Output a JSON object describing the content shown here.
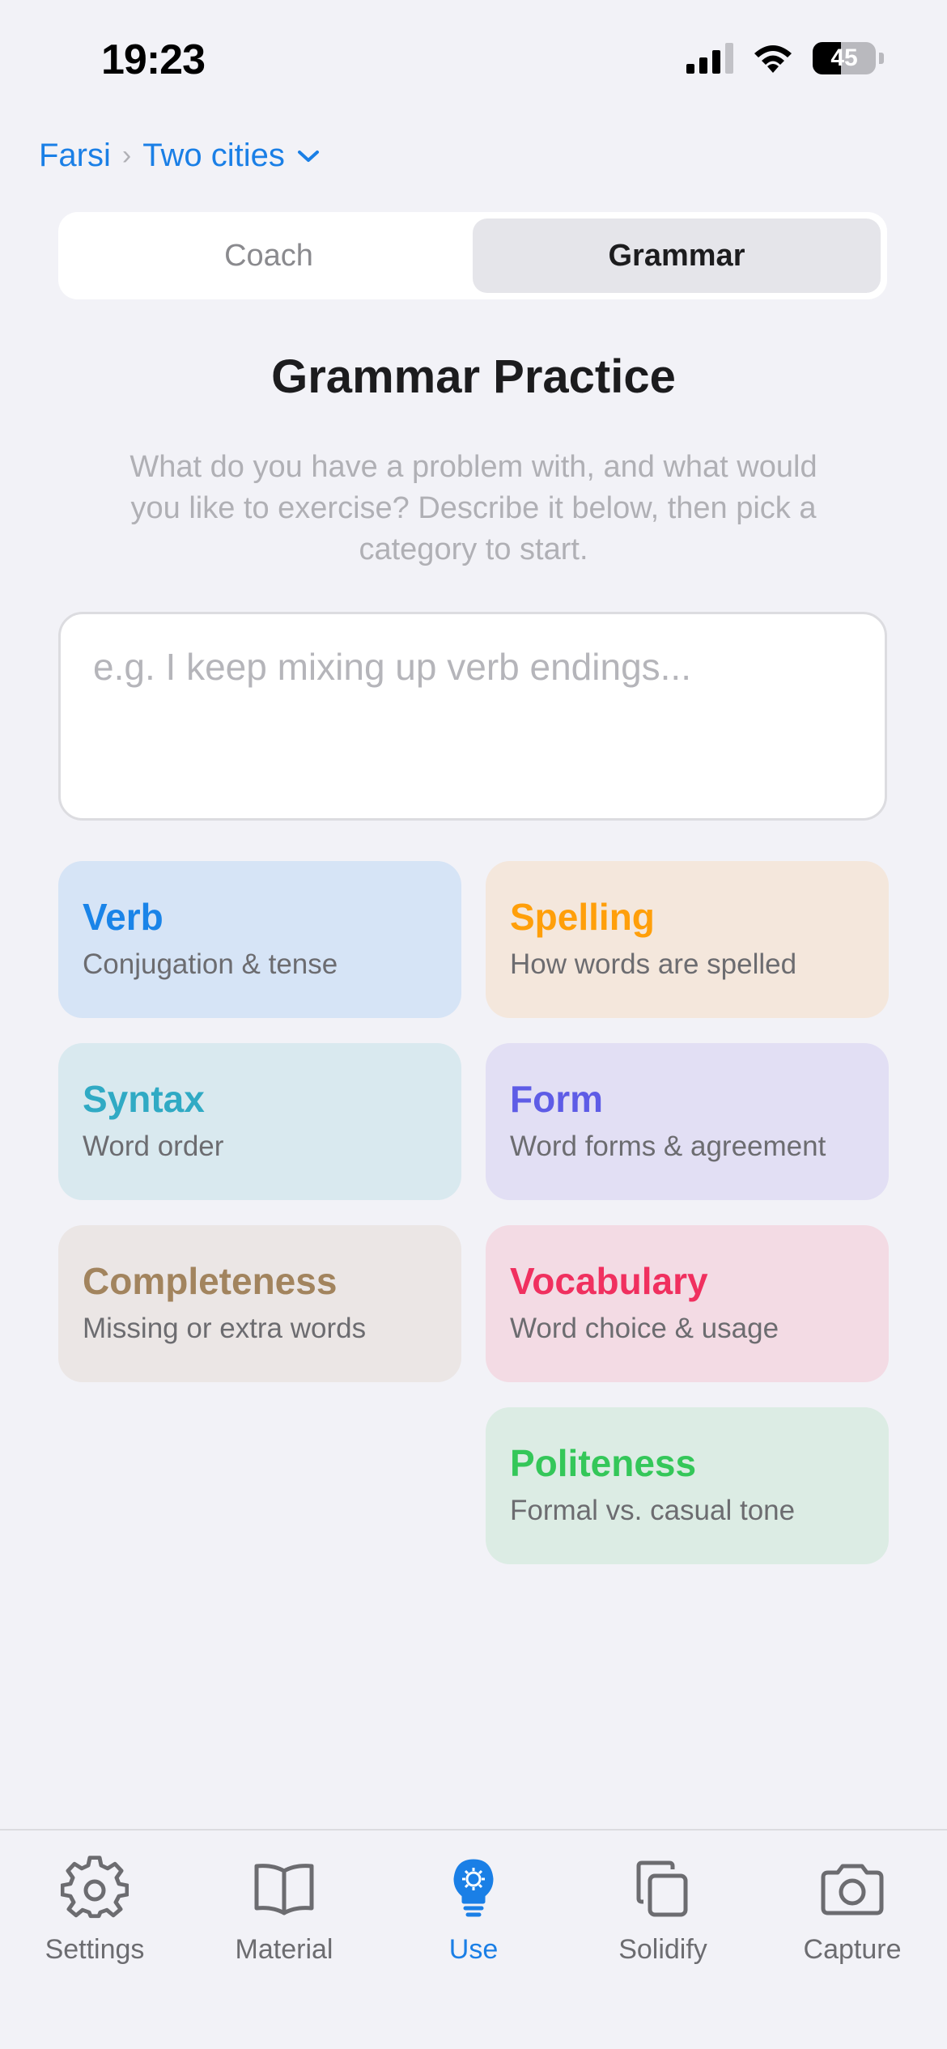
{
  "status_bar": {
    "time": "19:23",
    "battery_level": "45"
  },
  "breadcrumb": {
    "language": "Farsi",
    "separator": "›",
    "material": "Two cities"
  },
  "segments": [
    {
      "label": "Coach",
      "active": false
    },
    {
      "label": "Grammar",
      "active": true
    }
  ],
  "main": {
    "title": "Grammar Practice",
    "description": "What do you have a problem with, and what would you like to exercise? Describe it below, then pick a category to start.",
    "input_placeholder": "e.g. I keep mixing up verb endings...",
    "input_value": ""
  },
  "categories": [
    {
      "title": "Verb",
      "subtitle": "Conjugation & tense",
      "title_color": "#1a84e8",
      "bg_color": "#d6e4f6"
    },
    {
      "title": "Spelling",
      "subtitle": "How words are spelled",
      "title_color": "#ff9f0a",
      "bg_color": "#f4e7dc"
    },
    {
      "title": "Syntax",
      "subtitle": "Word order",
      "title_color": "#30aac4",
      "bg_color": "#d9e9ef"
    },
    {
      "title": "Form",
      "subtitle": "Word forms & agreement",
      "title_color": "#5e5ce6",
      "bg_color": "#e2dff4"
    },
    {
      "title": "Completeness",
      "subtitle": "Missing or extra words",
      "title_color": "#a2845e",
      "bg_color": "#ebe6e5"
    },
    {
      "title": "Vocabulary",
      "subtitle": "Word choice & usage",
      "title_color": "#f0305f",
      "bg_color": "#f3dbe4"
    },
    {
      "title": "Politeness",
      "subtitle": "Formal vs. casual tone",
      "title_color": "#34c759",
      "bg_color": "#dcece4"
    }
  ],
  "tab_bar": {
    "tabs": [
      {
        "label": "Settings",
        "icon": "gear-icon",
        "active": false
      },
      {
        "label": "Material",
        "icon": "book-icon",
        "active": false
      },
      {
        "label": "Use",
        "icon": "lightbulb-icon",
        "active": true
      },
      {
        "label": "Solidify",
        "icon": "copy-icon",
        "active": false
      },
      {
        "label": "Capture",
        "icon": "camera-icon",
        "active": false
      }
    ],
    "active_color": "#1a7fe6",
    "inactive_color": "#6c6c70"
  }
}
